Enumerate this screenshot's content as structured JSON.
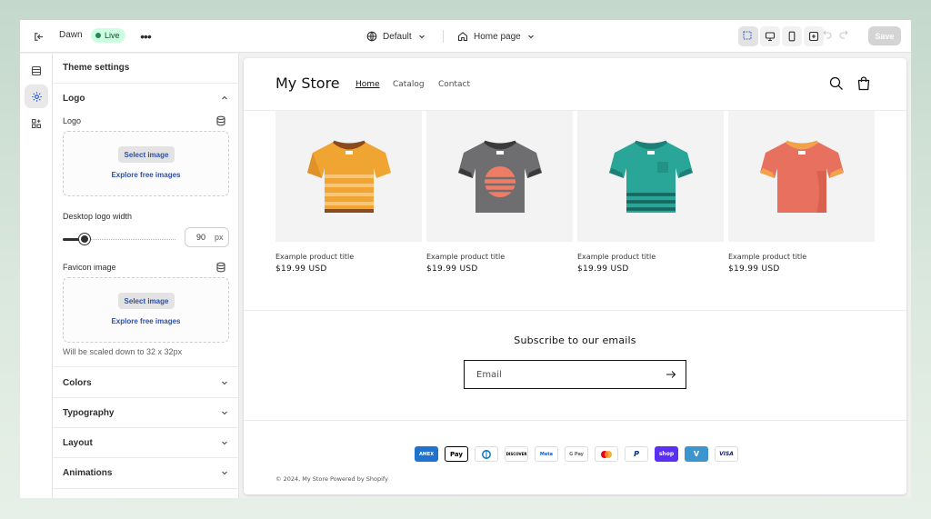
{
  "topbar": {
    "theme_name": "Dawn",
    "live_label": "Live",
    "preset_label": "Default",
    "template_label": "Home page",
    "save_label": "Save"
  },
  "panel": {
    "title": "Theme settings",
    "logo_section": {
      "title": "Logo",
      "logo_field_label": "Logo",
      "select_image": "Select image",
      "explore_images": "Explore free images",
      "width_label": "Desktop logo width",
      "width_value": "90",
      "width_unit": "px",
      "favicon_label": "Favicon image",
      "favicon_select": "Select image",
      "favicon_explore": "Explore free images",
      "favicon_help": "Will be scaled down to 32 x 32px"
    },
    "sections": [
      "Colors",
      "Typography",
      "Layout",
      "Animations"
    ]
  },
  "preview": {
    "store_name": "My Store",
    "nav": [
      "Home",
      "Catalog",
      "Contact"
    ],
    "products": [
      {
        "title": "Example product title",
        "price": "$19.99 USD",
        "shirt_color": "#f0a431"
      },
      {
        "title": "Example product title",
        "price": "$19.99 USD",
        "shirt_color": "#6e6e70"
      },
      {
        "title": "Example product title",
        "price": "$19.99 USD",
        "shirt_color": "#2aa699"
      },
      {
        "title": "Example product title",
        "price": "$19.99 USD",
        "shirt_color": "#e8705f"
      }
    ],
    "subscribe_title": "Subscribe to our emails",
    "email_placeholder": "Email",
    "payment_icons": [
      "amex-icon",
      "apple-pay-icon",
      "diners-icon",
      "discover-icon",
      "meta-pay-icon",
      "google-pay-icon",
      "mastercard-icon",
      "paypal-icon",
      "shop-pay-icon",
      "venmo-icon",
      "visa-icon"
    ],
    "payment_labels": {
      "amex": "AMEX",
      "apple_pay": "Pay",
      "discover": "DISCOVER",
      "meta_pay": "Meta",
      "google_pay": "G Pay",
      "paypal": "P",
      "shop_pay": "shop",
      "venmo": "V",
      "visa": "VISA"
    },
    "copyright": "© 2024, My Store Powered by Shopify"
  },
  "colors": {
    "live_badge": "#cdfee1",
    "link_blue": "#2c4fa8",
    "accent_dark": "#303030"
  }
}
